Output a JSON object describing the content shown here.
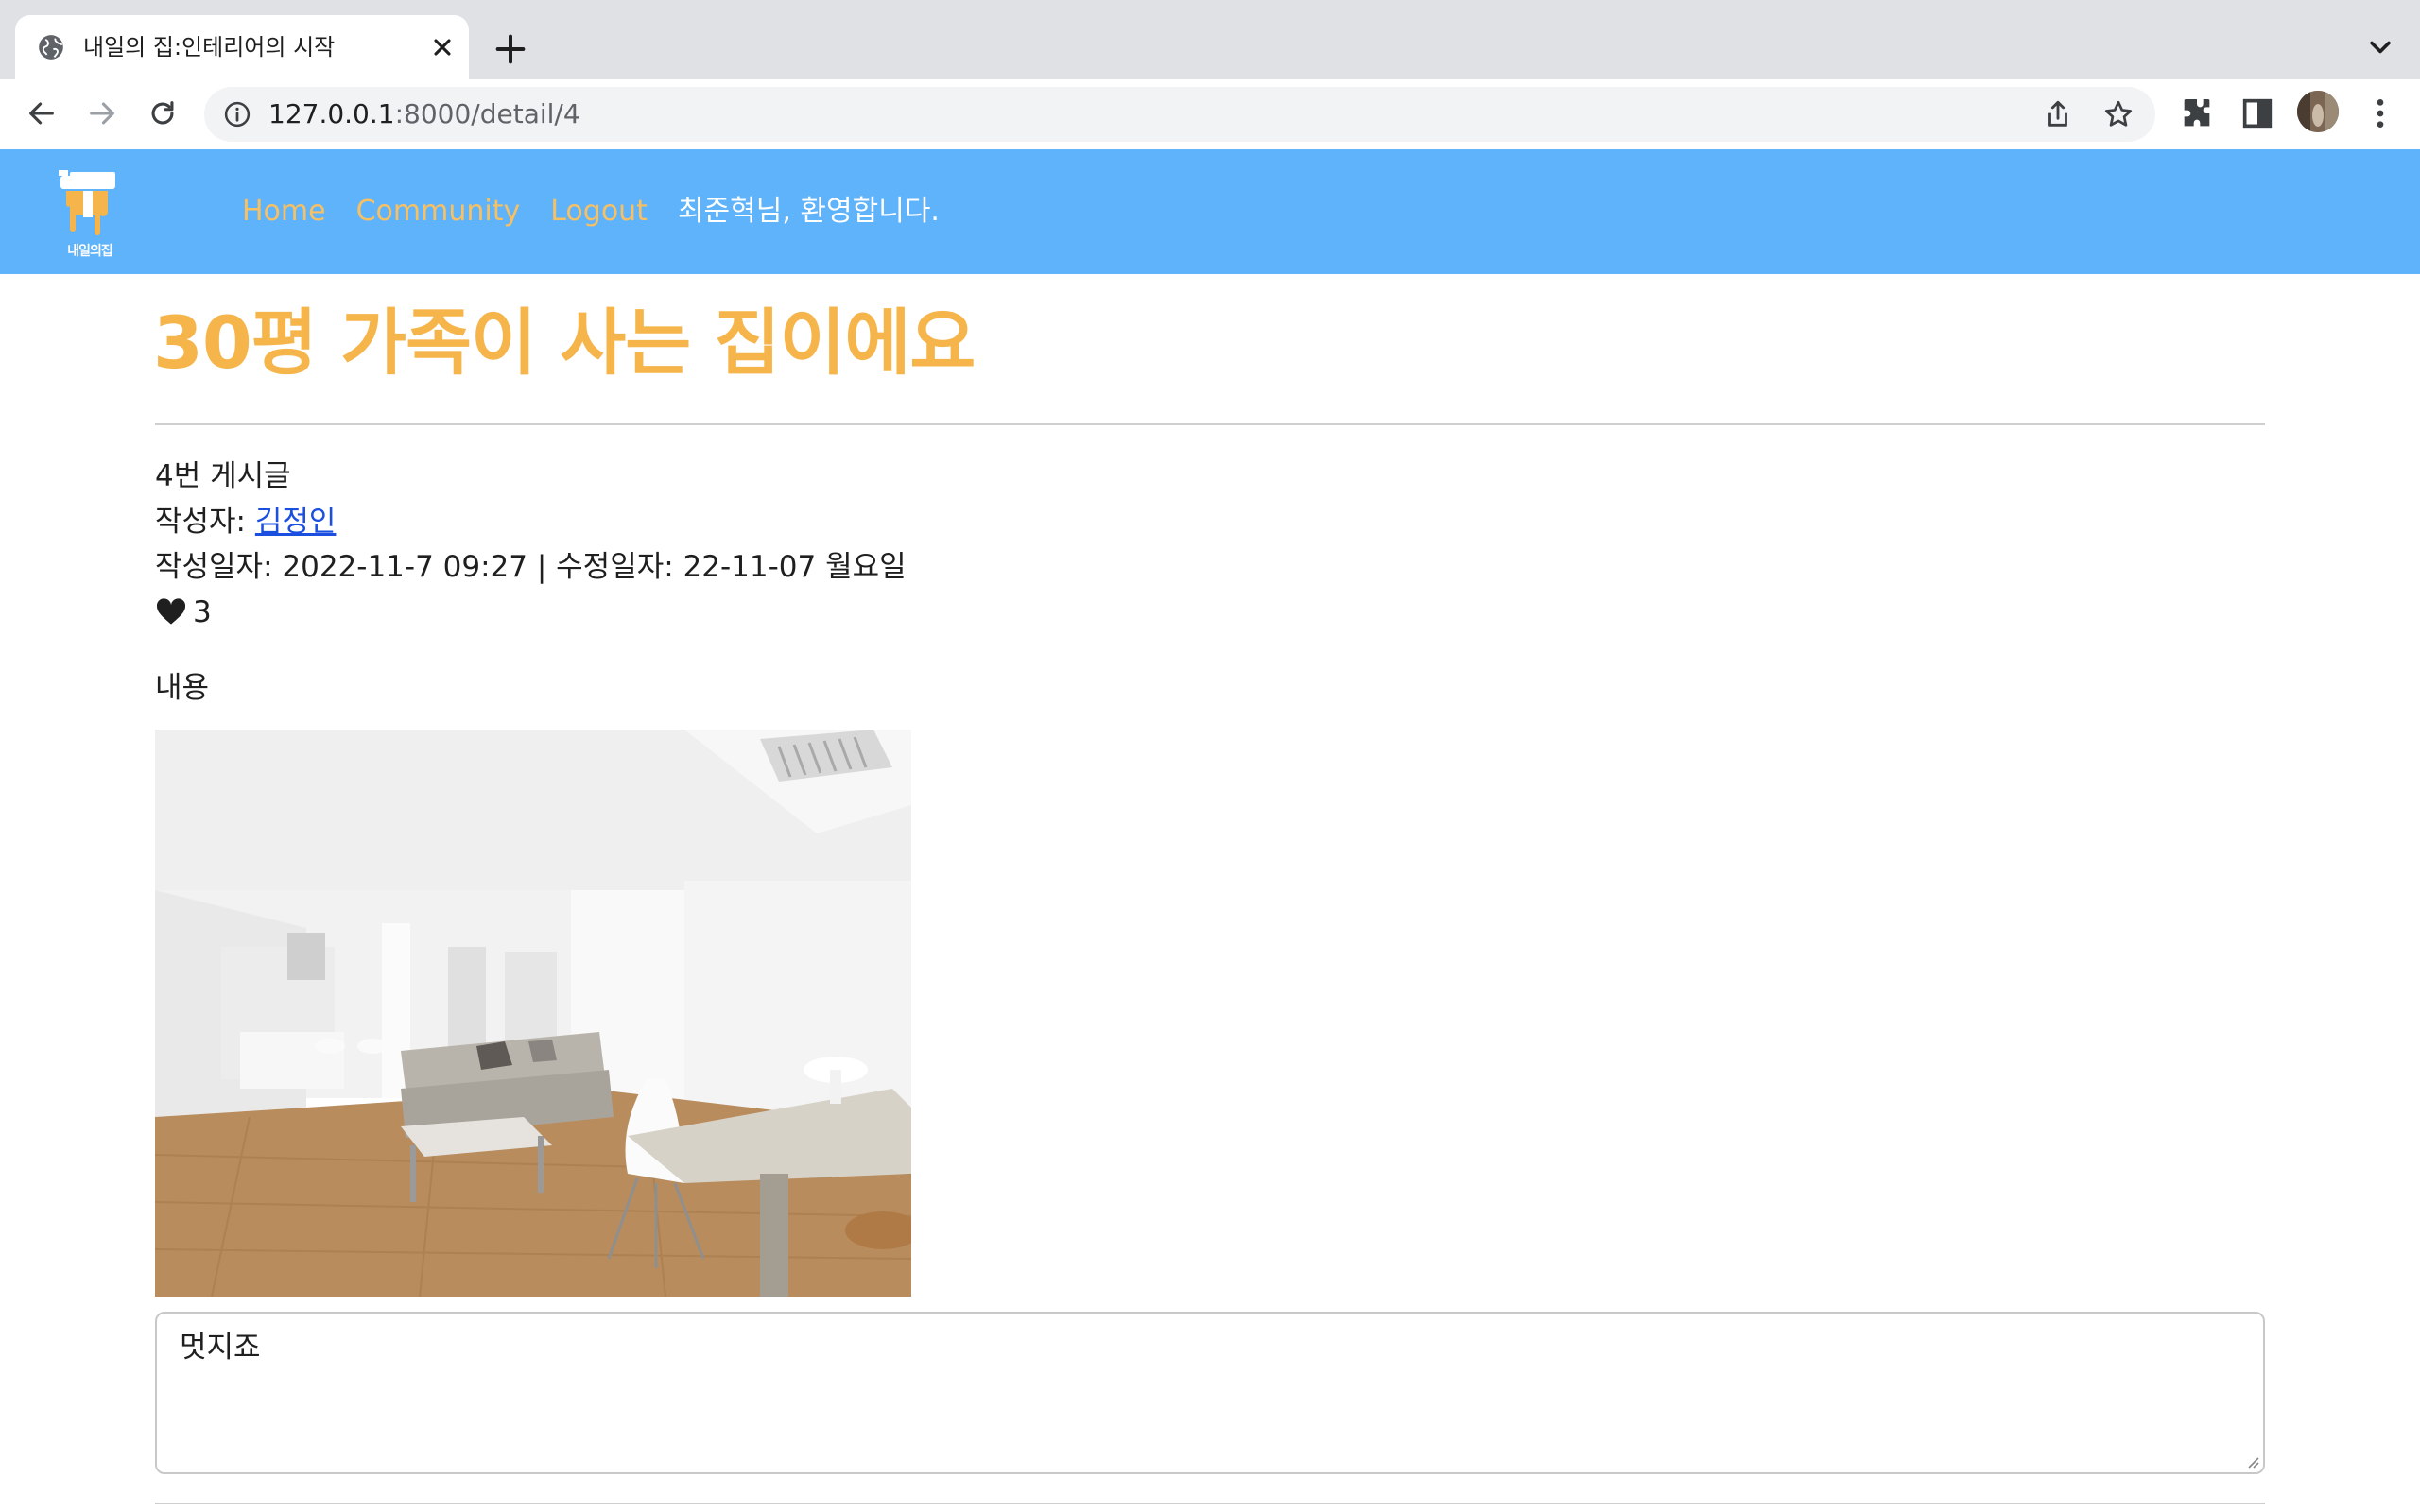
{
  "browser": {
    "tab_title": "내일의 집:인테리어의 시작",
    "url_host": "127.0.0.1",
    "url_path": ":8000/detail/4"
  },
  "site": {
    "logo_text": "내일의집",
    "nav": {
      "home": "Home",
      "community": "Community",
      "logout": "Logout",
      "welcome": "최준혁님, 환영합니다."
    },
    "colors": {
      "nav_bg": "#5eb3fb",
      "accent": "#f5b54b"
    }
  },
  "post": {
    "title": "30평 가족이 사는 집이에요",
    "number_label": "4번 게시글",
    "author_label": "작성자: ",
    "author_name": "김정인",
    "dates": "작성일자: 2022-11-7 09:27 | 수정일자: 22-11-07 월요일",
    "likes": "3",
    "content_label": "내용",
    "content_text": "멋지죠"
  }
}
